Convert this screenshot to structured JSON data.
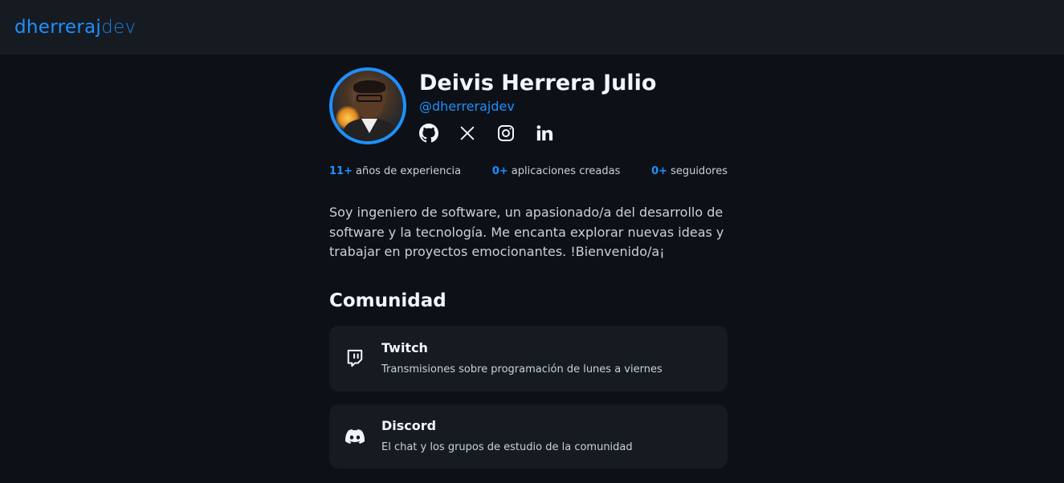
{
  "header": {
    "logo_part1": "dherreraj",
    "logo_part2": "dev"
  },
  "profile": {
    "name": "Deivis Herrera Julio",
    "handle": "@dherrerajdev",
    "socials": [
      "github-icon",
      "x-icon",
      "instagram-icon",
      "linkedin-icon"
    ]
  },
  "stats": [
    {
      "value": "11+",
      "label": "años de experiencia"
    },
    {
      "value": "0+",
      "label": "aplicaciones creadas"
    },
    {
      "value": "0+",
      "label": "seguidores"
    }
  ],
  "bio": "Soy ingeniero de software, un apasionado/a del desarrollo de software y la tecnología. Me encanta explorar nuevas ideas y trabajar en proyectos emocionantes. !Bienvenido/a¡",
  "community": {
    "title": "Comunidad",
    "items": [
      {
        "icon": "twitch-icon",
        "title": "Twitch",
        "description": "Transmisiones sobre programación de lunes a viernes"
      },
      {
        "icon": "discord-icon",
        "title": "Discord",
        "description": "El chat y los grupos de estudio de la comunidad"
      }
    ]
  },
  "colors": {
    "accent": "#1e90ff",
    "background": "#0d1117",
    "surface": "#161b22"
  }
}
